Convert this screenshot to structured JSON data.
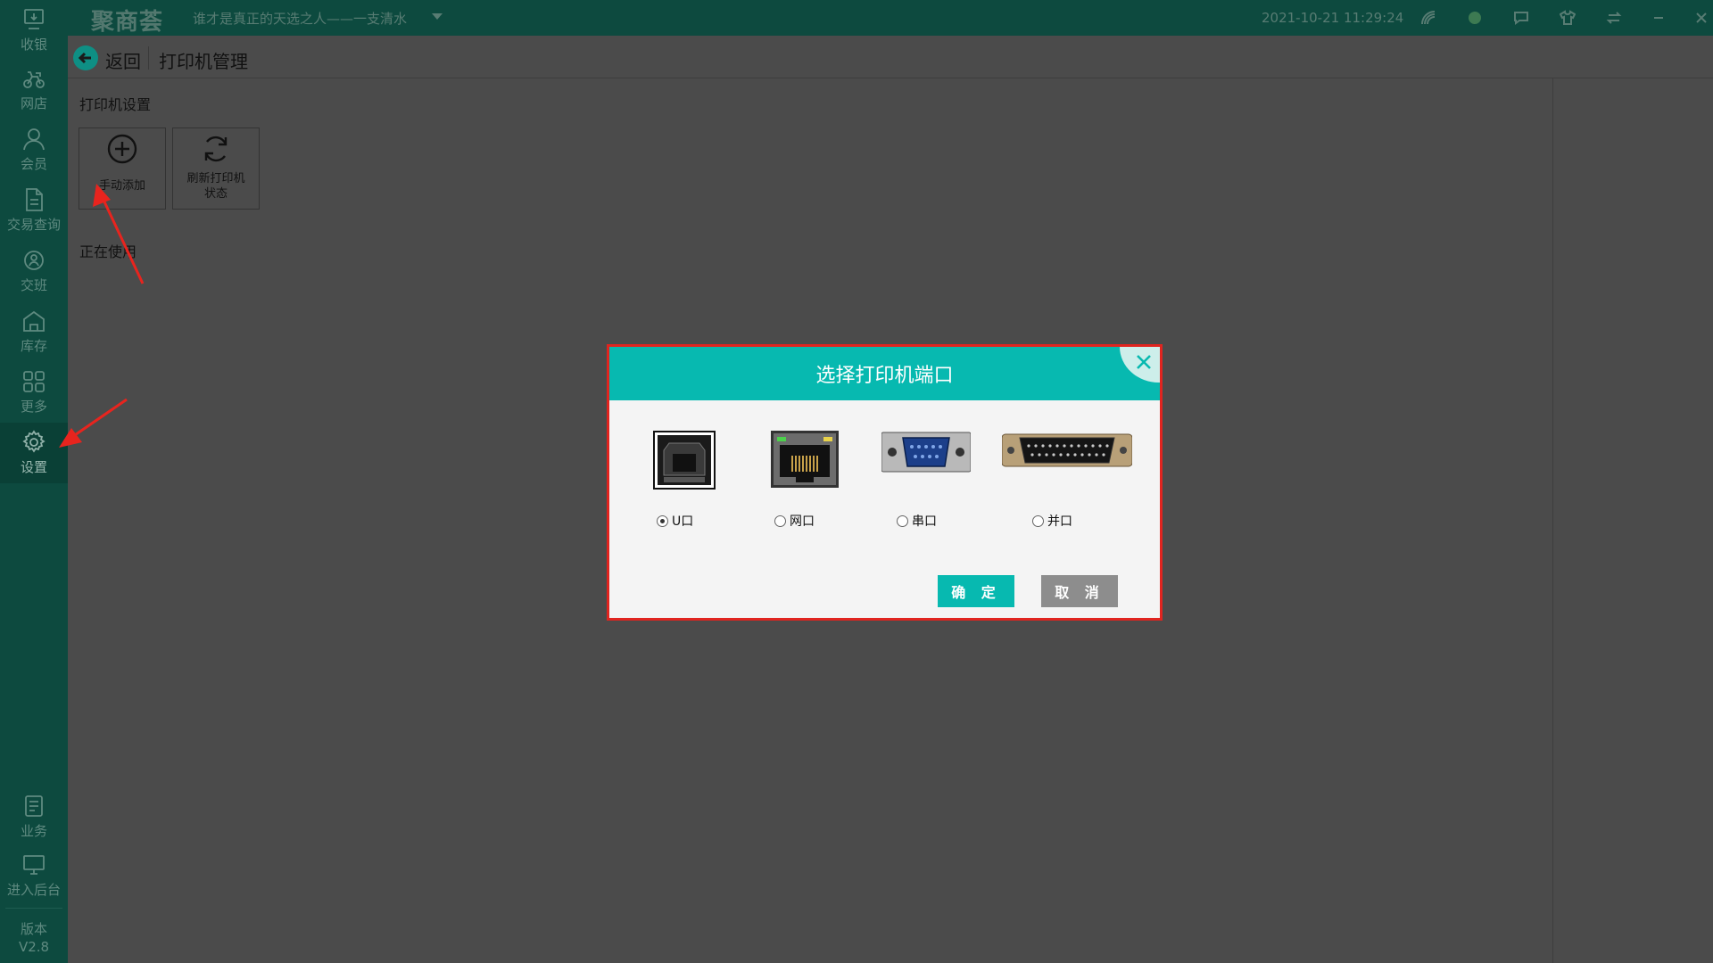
{
  "sidebar": {
    "items": [
      {
        "label": "收银",
        "icon": "cashier-icon"
      },
      {
        "label": "网店",
        "icon": "delivery-bike-icon"
      },
      {
        "label": "会员",
        "icon": "member-icon"
      },
      {
        "label": "交易查询",
        "icon": "document-icon"
      },
      {
        "label": "交班",
        "icon": "handover-icon"
      },
      {
        "label": "库存",
        "icon": "warehouse-icon"
      },
      {
        "label": "更多",
        "icon": "grid-icon"
      },
      {
        "label": "设置",
        "icon": "gear-icon"
      }
    ],
    "bottom_items": [
      {
        "label": "业务",
        "icon": "business-book-icon"
      },
      {
        "label": "进入后台",
        "icon": "monitor-icon"
      }
    ],
    "version_label": "版本",
    "version_value": "V2.8",
    "active": "设置"
  },
  "topbar": {
    "brand": "聚商荟",
    "slogan": "谁才是真正的天选之人——一支清水",
    "datetime": "2021-10-21 11:29:24"
  },
  "subheader": {
    "back_label": "返回",
    "page_title": "打印机管理"
  },
  "content": {
    "section_title": "打印机设置",
    "add_button": "手动添加",
    "refresh_button_line1": "刷新打印机",
    "refresh_button_line2": "状态",
    "in_use_label": "正在使用"
  },
  "dialog": {
    "title": "选择打印机端口",
    "ports": [
      {
        "label": "U口",
        "icon": "usb-port-icon",
        "checked": true
      },
      {
        "label": "网口",
        "icon": "ethernet-port-icon",
        "checked": false
      },
      {
        "label": "串口",
        "icon": "serial-port-icon",
        "checked": false
      },
      {
        "label": "并口",
        "icon": "parallel-port-icon",
        "checked": false
      }
    ],
    "ok_label": "确 定",
    "cancel_label": "取 消"
  },
  "colors": {
    "accent": "#07b9b0",
    "sidebar_bg": "#0d4a3f",
    "overlay_bg": "#4b4b4b",
    "dialog_border": "#e0241f",
    "annotation": "#e8241e"
  }
}
